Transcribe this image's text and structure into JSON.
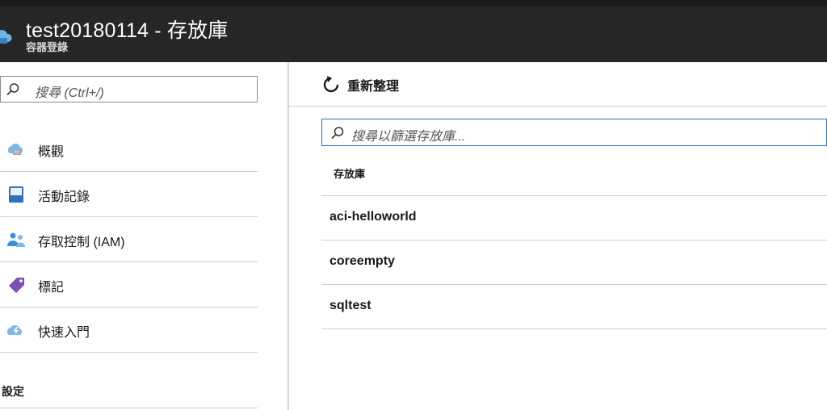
{
  "header": {
    "title": "test20180114 - 存放庫",
    "subtitle": "容器登錄"
  },
  "sidebar": {
    "search_placeholder": "搜尋 (Ctrl+/)",
    "items": [
      {
        "label": "概觀",
        "icon": "cloud-overview-icon"
      },
      {
        "label": "活動記錄",
        "icon": "activity-log-icon"
      },
      {
        "label": "存取控制 (IAM)",
        "icon": "access-control-icon"
      },
      {
        "label": "標記",
        "icon": "tag-icon"
      },
      {
        "label": "快速入門",
        "icon": "quickstart-cloud-icon"
      }
    ],
    "section_label": "設定"
  },
  "main": {
    "refresh_label": "重新整理",
    "filter_placeholder": "搜尋以篩選存放庫...",
    "column_header": "存放庫",
    "repositories": [
      "aci-helloworld",
      "coreempty",
      "sqltest"
    ]
  },
  "colors": {
    "header_bg": "#262626",
    "filter_border": "#2a6fc9",
    "tag_purple": "#7b4fb5",
    "log_blue": "#2f72c4",
    "iam_blue": "#3b8ed8"
  }
}
